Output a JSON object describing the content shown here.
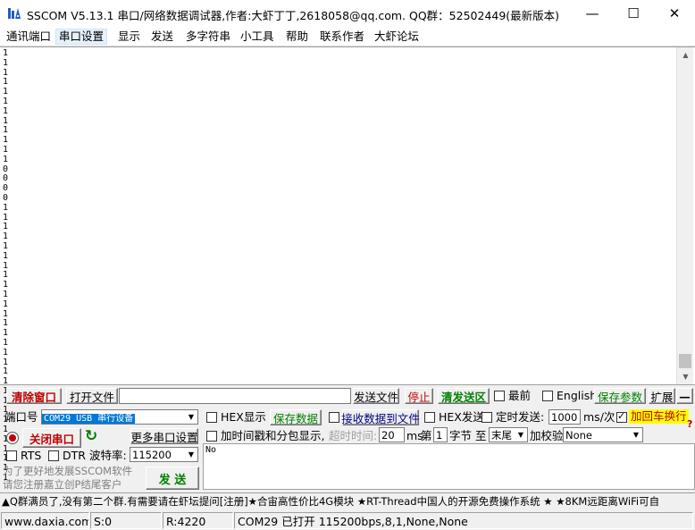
{
  "window": {
    "title": "SSCOM V5.13.1 串口/网络数据调试器,作者:大虾丁丁,2618058@qq.com. QQ群：52502449(最新版本)",
    "minimize_glyph": "—",
    "maximize_glyph": "☐",
    "close_glyph": "✕"
  },
  "menu": [
    "通讯端口",
    "串口设置",
    "显示",
    "发送",
    "多字符串",
    "小工具",
    "帮助",
    "联系作者",
    "大虾论坛"
  ],
  "receive": {
    "lines": [
      "1",
      "1",
      "1",
      "1",
      "1",
      "1",
      "1",
      "1",
      "1",
      "1",
      "1",
      "1",
      "0",
      "0",
      "0",
      "0",
      "1",
      "1",
      "1",
      "1",
      "1",
      "1",
      "1",
      "1",
      "1",
      "1",
      "1",
      "1",
      "1",
      "1",
      "1",
      "1",
      "1",
      "1",
      "1",
      "1",
      "1",
      "1",
      "1",
      "1",
      "1",
      "1",
      "1",
      "1",
      "1"
    ],
    "scroll_up_glyph": "▲",
    "scroll_down_glyph": "▼"
  },
  "toolbar": {
    "clear_window": "清除窗口",
    "open_file": "打开文件",
    "file_path": "",
    "send_file": "发送文件",
    "stop": "停止",
    "clear_send": "清发送区",
    "latest": "最前",
    "english": "English",
    "save_params": "保存参数",
    "expand": "扩展",
    "collapse": "—"
  },
  "port": {
    "port_label": "端口号",
    "port_value": "COM29 USB 串行设备",
    "close_port": "关闭串口",
    "refresh_glyph": "↻",
    "more_settings": "更多串口设置",
    "rts": "RTS",
    "dtr": "DTR",
    "baud_label": "波特率:",
    "baud_value": "115200"
  },
  "options": {
    "hex_display": "HEX显示",
    "save_data": "保存数据",
    "recv_to_file": "接收数据到文件",
    "hex_send": "HEX发送",
    "timed_send": "定时发送:",
    "interval_value": "1000",
    "interval_unit": "ms/次",
    "add_crlf": "加回车换行",
    "crlf_checked": true,
    "timestamp": "加时间戳和分包显示,",
    "timeout_label": "超时时间:",
    "timeout_value": "20",
    "timeout_unit": "ms",
    "byte_prefix": "第",
    "byte_value": "1",
    "byte_label": "字节 至",
    "to_value": "末尾",
    "checksum_label": "加校验",
    "checksum_value": "None",
    "question_glyph": "?"
  },
  "send": {
    "text": "No",
    "send_button": "发  送",
    "promo_line1": "为了更好地发展SSCOM软件",
    "promo_line2": "请您注册嘉立创P结尾客户"
  },
  "ticker": "▲Q群满员了,没有第二个群.有需要请在虾坛提问[注册]★合宙高性价比4G模块 ★RT-Thread中国人的开源免费操作系统 ★ ★8KM远距离WiFi可自",
  "status": {
    "website": "www.daxia.com",
    "sent": "S:0",
    "received": "R:4220",
    "port_status": "COM29 已打开  115200bps,8,1,None,None"
  },
  "colors": {
    "accent_red": "#c00000",
    "accent_green": "#008000",
    "crlf_highlight": "#ffff00",
    "combo_selection": "#0078d7"
  }
}
